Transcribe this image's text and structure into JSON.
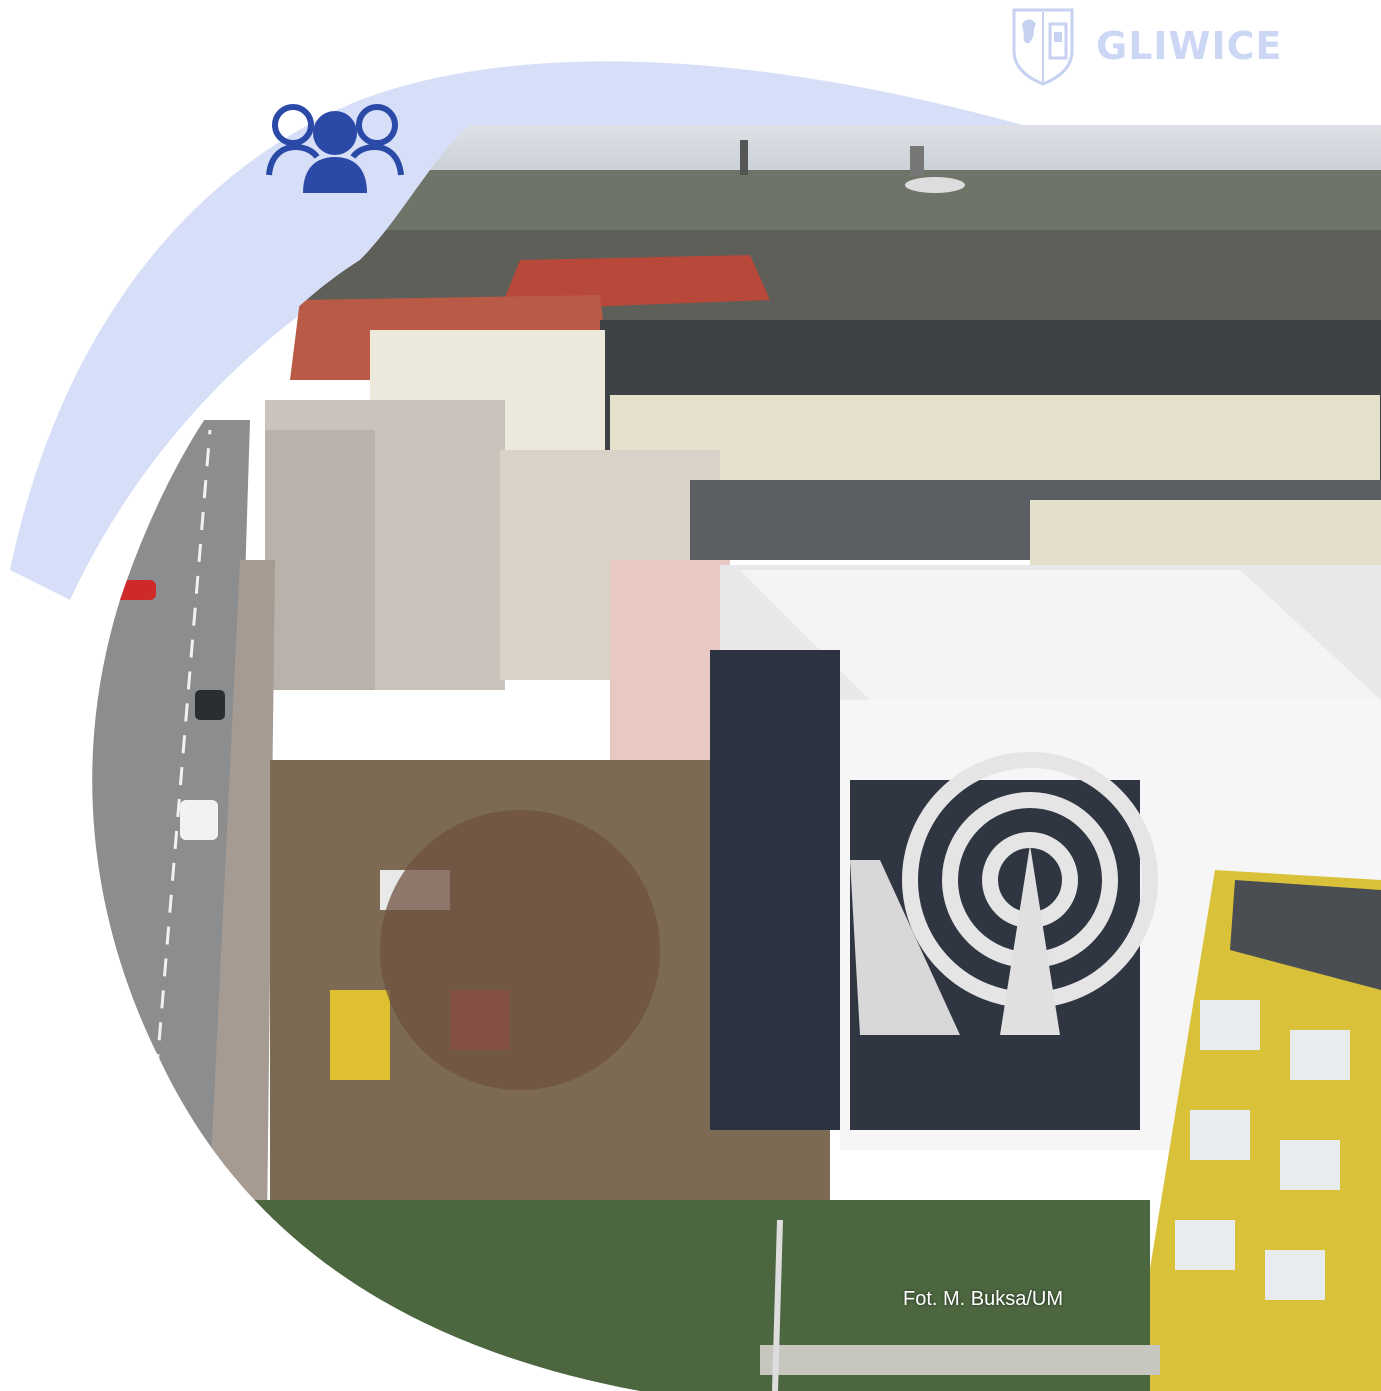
{
  "brand": {
    "name": "GLIWICE",
    "emblem_icon": "city-coat-of-arms-icon"
  },
  "badge": {
    "icon": "group-people-icon",
    "color": "#2b4aa8"
  },
  "photo": {
    "credit": "Fot. M. Buksa/UM"
  },
  "colors": {
    "accent_light": "#d6dff7",
    "accent_blue": "#2b4aa8",
    "brand_text": "#ccd6f5"
  }
}
